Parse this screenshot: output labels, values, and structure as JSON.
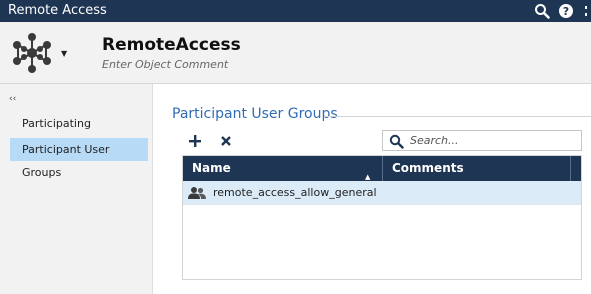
{
  "window": {
    "title": "Remote Access",
    "icons": [
      "search-icon",
      "help-icon",
      "more-icon"
    ]
  },
  "header": {
    "object_name": "RemoteAccess",
    "comment_placeholder": "Enter Object Comment",
    "object_icon": "network-hub-icon"
  },
  "sidebar": {
    "collapse_glyph": "‹‹",
    "items": [
      {
        "label": "Participating Gateways",
        "selected": false
      },
      {
        "label": "Participant User Groups",
        "selected": true
      }
    ]
  },
  "main": {
    "section_title": "Participant User Groups",
    "toolbar": {
      "add_icon": "plus-icon",
      "remove_icon": "close-icon"
    },
    "search": {
      "placeholder": "Search...",
      "value": ""
    },
    "table": {
      "columns": [
        {
          "label": "Name",
          "sort": "ascending"
        },
        {
          "label": "Comments"
        }
      ],
      "rows": [
        {
          "name": "remote_access_allow_general",
          "comments": "",
          "icon": "user-group-icon"
        }
      ]
    }
  },
  "colors": {
    "titlebar": "#1f3554",
    "header_bg": "#f2f2f2",
    "accent_blue": "#2f6db6",
    "selection": "#b7daf6",
    "row_selected": "#dbebf8"
  }
}
